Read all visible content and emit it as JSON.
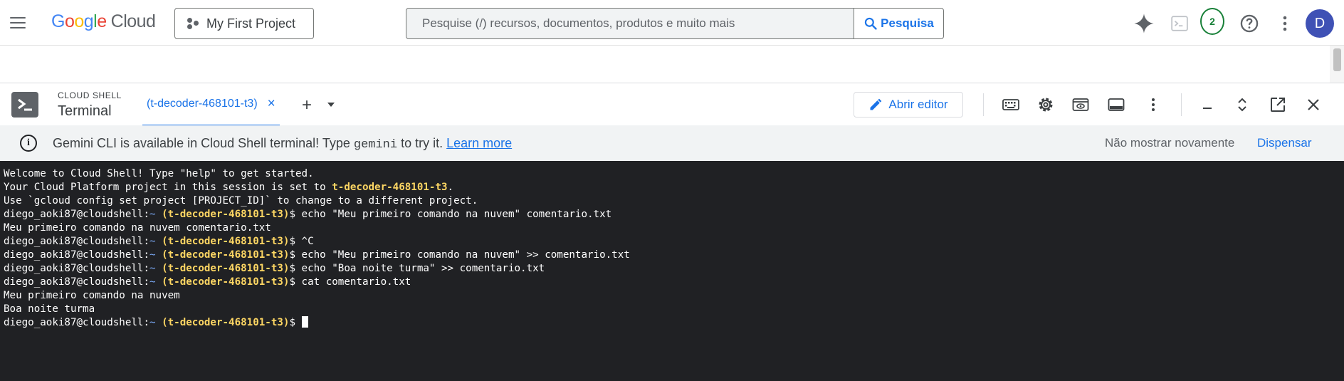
{
  "topbar": {
    "logo": {
      "google": "Google",
      "cloud": "Cloud"
    },
    "project": "My First Project",
    "search": {
      "placeholder": "Pesquise (/) recursos, documentos, produtos e muito mais",
      "button_label": "Pesquisa"
    },
    "notifications_count": "2",
    "avatar_initial": "D"
  },
  "shell": {
    "subtitle": "CLOUD SHELL",
    "title": "Terminal",
    "tab_label": "(t-decoder-468101-t3)",
    "tab_close": "×",
    "add_tab": "+",
    "editor_button": "Abrir editor"
  },
  "banner": {
    "text_before": "Gemini CLI is available in Cloud Shell terminal! Type ",
    "code": "gemini",
    "text_after": " to try it. ",
    "learn_more": "Learn more",
    "dont_show": "Não mostrar novamente",
    "dismiss": "Dispensar"
  },
  "terminal": {
    "lines": [
      [
        {
          "t": "Welcome to Cloud Shell! Type \"help\" to get started."
        }
      ],
      [
        {
          "t": "Your Cloud Platform project in this session is set to "
        },
        {
          "t": "t-decoder-468101-t3",
          "c": "yl"
        },
        {
          "t": "."
        }
      ],
      [
        {
          "t": "Use `gcloud config set project [PROJECT_ID]` to change to a different project."
        }
      ],
      [
        {
          "t": "diego_aoki87@cloudshell:"
        },
        {
          "t": "~",
          "c": "bl"
        },
        {
          "t": " "
        },
        {
          "t": "(t-decoder-468101-t3)",
          "c": "yl"
        },
        {
          "t": "$ echo \"Meu primeiro comando na nuvem\" comentario.txt"
        }
      ],
      [
        {
          "t": "Meu primeiro comando na nuvem comentario.txt"
        }
      ],
      [
        {
          "t": "diego_aoki87@cloudshell:"
        },
        {
          "t": "~",
          "c": "bl"
        },
        {
          "t": " "
        },
        {
          "t": "(t-decoder-468101-t3)",
          "c": "yl"
        },
        {
          "t": "$ ^C"
        }
      ],
      [
        {
          "t": "diego_aoki87@cloudshell:"
        },
        {
          "t": "~",
          "c": "bl"
        },
        {
          "t": " "
        },
        {
          "t": "(t-decoder-468101-t3)",
          "c": "yl"
        },
        {
          "t": "$ echo \"Meu primeiro comando na nuvem\" >> comentario.txt"
        }
      ],
      [
        {
          "t": "diego_aoki87@cloudshell:"
        },
        {
          "t": "~",
          "c": "bl"
        },
        {
          "t": " "
        },
        {
          "t": "(t-decoder-468101-t3)",
          "c": "yl"
        },
        {
          "t": "$ echo \"Boa noite turma\" >> comentario.txt"
        }
      ],
      [
        {
          "t": "diego_aoki87@cloudshell:"
        },
        {
          "t": "~",
          "c": "bl"
        },
        {
          "t": " "
        },
        {
          "t": "(t-decoder-468101-t3)",
          "c": "yl"
        },
        {
          "t": "$ cat comentario.txt"
        }
      ],
      [
        {
          "t": "Meu primeiro comando na nuvem"
        }
      ],
      [
        {
          "t": "Boa noite turma"
        }
      ],
      [
        {
          "t": "diego_aoki87@cloudshell:"
        },
        {
          "t": "~",
          "c": "bl"
        },
        {
          "t": " "
        },
        {
          "t": "(t-decoder-468101-t3)",
          "c": "yl"
        },
        {
          "t": "$ "
        }
      ]
    ]
  },
  "colors": {
    "accent": "#1a73e8",
    "terminal_bg": "#202124",
    "project_highlight": "#fdd663",
    "notification_green": "#188038",
    "avatar_bg": "#3f51b5"
  }
}
